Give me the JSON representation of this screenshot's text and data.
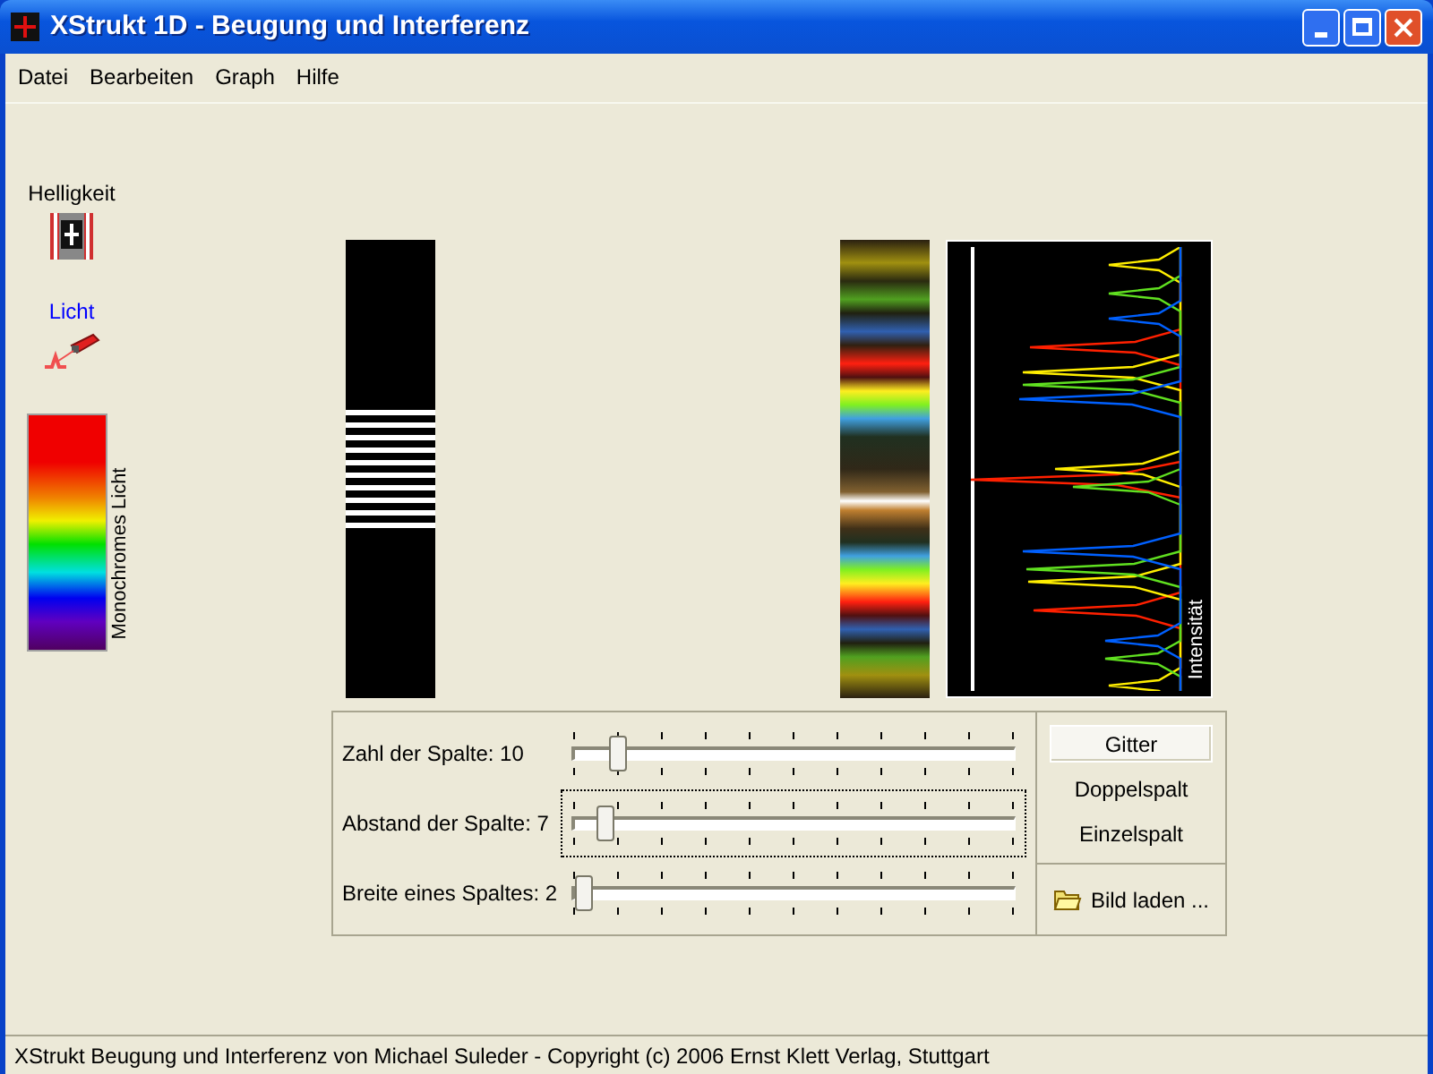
{
  "window": {
    "title": "XStrukt 1D - Beugung und Interferenz"
  },
  "menu": [
    {
      "label": "Datei"
    },
    {
      "label": "Bearbeiten"
    },
    {
      "label": "Graph"
    },
    {
      "label": "Hilfe"
    }
  ],
  "sidebar": {
    "items": [
      {
        "label": "Helligkeit",
        "kind": "film",
        "selected": false
      },
      {
        "label": "Licht",
        "kind": "laser",
        "selected": true
      }
    ],
    "color_scale_label": "Monochromes Licht"
  },
  "graph": {
    "label": "Intensität"
  },
  "sliders": [
    {
      "label": "Zahl der Spalte: 10",
      "level": 0.09,
      "focused": false
    },
    {
      "label": "Abstand der Spalte: 7",
      "level": 0.06,
      "focused": true
    },
    {
      "label": "Breite eines Spaltes: 2",
      "level": 0.01,
      "focused": false
    }
  ],
  "modes": [
    {
      "label": "Gitter",
      "selected": true
    },
    {
      "label": "Doppelspalt",
      "selected": false
    },
    {
      "label": "Einzelspalt",
      "selected": false
    }
  ],
  "load_button": {
    "label": "Bild laden ..."
  },
  "status_bar": "XStrukt Beugung und Interferenz von Michael Suleder - Copyright (c) 2006 Ernst Klett Verlag, Stuttgart"
}
